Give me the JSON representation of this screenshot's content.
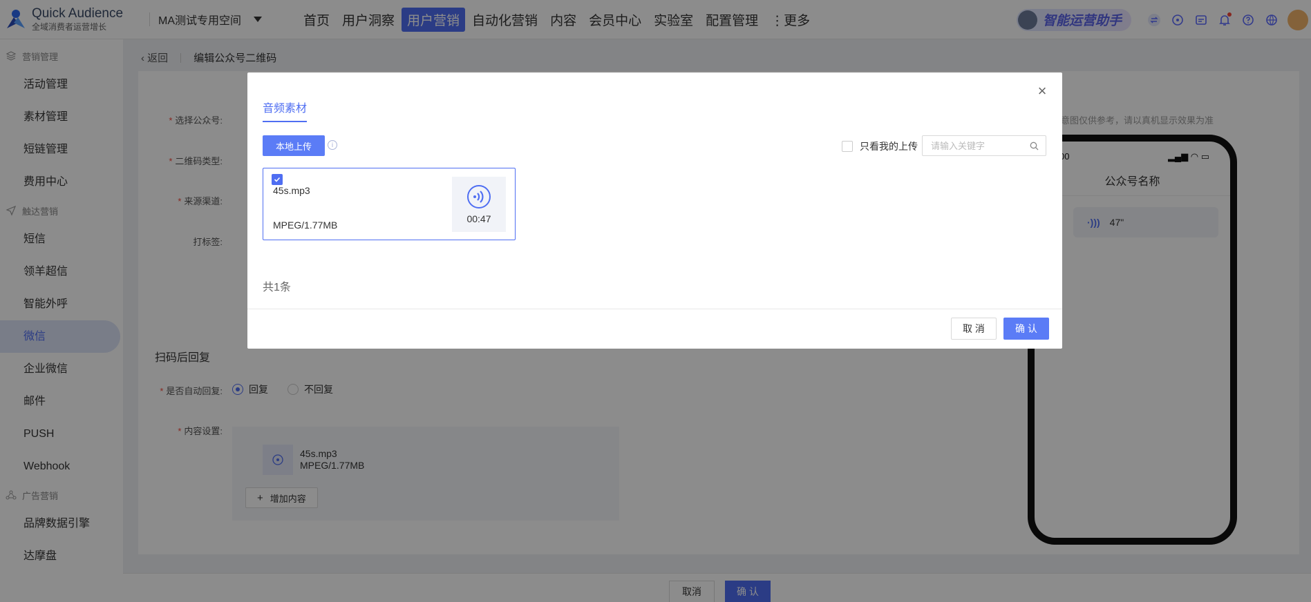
{
  "app": {
    "title": "Quick Audience",
    "subtitle": "全域消费者运营增长",
    "workspace": "MA测试专用空间"
  },
  "nav": {
    "items": [
      "首页",
      "用户洞察",
      "用户营销",
      "自动化营销",
      "内容",
      "会员中心",
      "实验室",
      "配置管理",
      "⋮更多"
    ],
    "active_index": 2
  },
  "header": {
    "assistant_label": "智能运营助手"
  },
  "sidebar": {
    "groups": [
      {
        "label": "营销管理",
        "icon": "layers-icon",
        "items": [
          "活动管理",
          "素材管理",
          "短链管理",
          "费用中心"
        ]
      },
      {
        "label": "触达营销",
        "icon": "send-icon",
        "items": [
          "短信",
          "领羊超信",
          "智能外呼",
          "微信",
          "企业微信",
          "邮件",
          "PUSH",
          "Webhook"
        ]
      },
      {
        "label": "广告营销",
        "icon": "network-icon",
        "items": [
          "品牌数据引擎",
          "达摩盘"
        ]
      }
    ],
    "active_item": "微信"
  },
  "breadcrumb": {
    "back": "返回",
    "title": "编辑公众号二维码"
  },
  "form": {
    "labels": {
      "account": "选择公众号:",
      "qr_type": "二维码类型:",
      "source": "来源渠道:",
      "tag": "打标签:"
    },
    "reply_section_title": "扫码后回复",
    "auto_reply_label": "是否自动回复:",
    "auto_reply_options": [
      "回复",
      "不回复"
    ],
    "auto_reply_selected": "回复",
    "content_label": "内容设置:",
    "content_file_name": "45s.mp3",
    "content_file_info": "MPEG/1.77MB",
    "add_content": "增加内容"
  },
  "preview": {
    "tip": "意图仅供参考，请以真机显示效果为准",
    "time": "00",
    "account_name": "公众号名称",
    "bubble_duration": "47\""
  },
  "bottom": {
    "cancel": "取消",
    "confirm": "确 认"
  },
  "modal": {
    "tab": "音频素材",
    "upload": "本地上传",
    "only_mine": "只看我的上传",
    "search_placeholder": "请输入关键字",
    "file": {
      "name": "45s.mp3",
      "info": "MPEG/1.77MB",
      "duration": "00:47",
      "checked": true
    },
    "total": "共1条",
    "cancel": "取 消",
    "confirm": "确 认"
  },
  "colors": {
    "primary": "#4f6ef2",
    "danger": "#f5483b"
  }
}
